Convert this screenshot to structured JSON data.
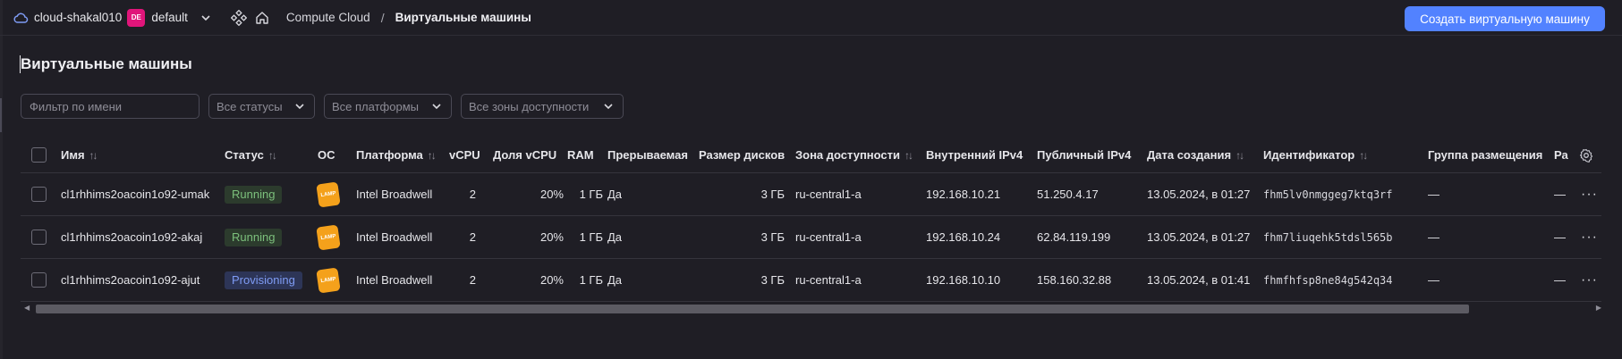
{
  "header": {
    "cloud_name": "cloud-shakal010",
    "folder_badge": "DE",
    "folder_name": "default",
    "breadcrumb_service": "Compute Cloud",
    "breadcrumb_separator": "/",
    "breadcrumb_current": "Виртуальные машины",
    "create_button": "Создать виртуальную машину"
  },
  "page": {
    "title": "Виртуальные машины"
  },
  "filters": {
    "name_placeholder": "Фильтр по имени",
    "status": "Все статусы",
    "platform": "Все платформы",
    "zone": "Все зоны доступности"
  },
  "table": {
    "columns": {
      "name": "Имя",
      "status": "Статус",
      "os": "ОС",
      "platform": "Платформа",
      "vcpu": "vCPU",
      "vcpu_share": "Доля vCPU",
      "ram": "RAM",
      "preemptible": "Прерываемая",
      "disk_size": "Размер дисков",
      "zone": "Зона доступности",
      "internal_ip": "Внутренний IPv4",
      "public_ip": "Публичный IPv4",
      "created": "Дата создания",
      "id": "Идентификатор",
      "placement_group": "Группа размещения",
      "more": "Ра"
    },
    "sort_icon": "↑↓",
    "rows": [
      {
        "name": "cl1rhhims2oacoin1o92-umak",
        "status": "Running",
        "os_label": "LAMP",
        "platform": "Intel Broadwell",
        "vcpu": "2",
        "vcpu_share": "20%",
        "ram": "1 ГБ",
        "preemptible": "Да",
        "disk_size": "3 ГБ",
        "zone": "ru-central1-a",
        "internal_ip": "192.168.10.21",
        "public_ip": "51.250.4.17",
        "created": "13.05.2024, в 01:27",
        "id": "fhm5lv0nmggeg7ktq3rf",
        "placement_group": "—",
        "extra": "—"
      },
      {
        "name": "cl1rhhims2oacoin1o92-akaj",
        "status": "Running",
        "os_label": "LAMP",
        "platform": "Intel Broadwell",
        "vcpu": "2",
        "vcpu_share": "20%",
        "ram": "1 ГБ",
        "preemptible": "Да",
        "disk_size": "3 ГБ",
        "zone": "ru-central1-a",
        "internal_ip": "192.168.10.24",
        "public_ip": "62.84.119.199",
        "created": "13.05.2024, в 01:27",
        "id": "fhm7liuqehk5tdsl565b",
        "placement_group": "—",
        "extra": "—"
      },
      {
        "name": "cl1rhhims2oacoin1o92-ajut",
        "status": "Provisioning",
        "os_label": "LAMP",
        "platform": "Intel Broadwell",
        "vcpu": "2",
        "vcpu_share": "20%",
        "ram": "1 ГБ",
        "preemptible": "Да",
        "disk_size": "3 ГБ",
        "zone": "ru-central1-a",
        "internal_ip": "192.168.10.10",
        "public_ip": "158.160.32.88",
        "created": "13.05.2024, в 01:41",
        "id": "fhmfhfsp8ne84g542q34",
        "placement_group": "—",
        "extra": "—"
      }
    ],
    "row_menu": "···"
  },
  "colors": {
    "background": "#1f1e25",
    "accent": "#5282ff",
    "running": "#7cc07c",
    "provisioning": "#7f9cf5",
    "folder_badge": "#e0157a",
    "os_icon": "#f4a11b"
  }
}
